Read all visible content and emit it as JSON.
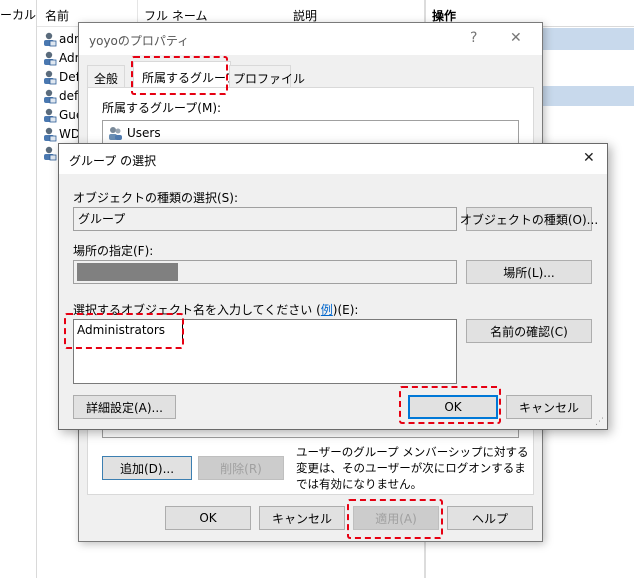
{
  "background": {
    "left_fragment": "ーカル)",
    "columns": {
      "name": "名前",
      "fullname": "フル ネーム",
      "description": "説明"
    },
    "ops_header": "操作",
    "rows": [
      "adm",
      "Adm",
      "Def",
      "def",
      "Gue",
      "WD",
      ""
    ]
  },
  "props_window": {
    "title": "yoyoのプロパティ",
    "help_glyph": "?",
    "close_glyph": "✕",
    "tabs": [
      "全般",
      "所属するグループ",
      "プロファイル"
    ],
    "member_of_label": "所属するグループ(M):",
    "groups": [
      "Users"
    ],
    "add_button": "追加(D)...",
    "remove_button": "削除(R)",
    "note": "ユーザーのグループ メンバーシップに対する変更は、そのユーザーが次にログオンするまでは有効になりません。",
    "ok": "OK",
    "cancel": "キャンセル",
    "apply": "適用(A)",
    "help": "ヘルプ"
  },
  "select_dialog": {
    "title": "グループ の選択",
    "close_glyph": "✕",
    "object_type_label": "オブジェクトの種類の選択(S):",
    "object_type_value": "グループ",
    "object_type_button": "オブジェクトの種類(O)...",
    "location_label": "場所の指定(F):",
    "location_button": "場所(L)...",
    "enter_label_prefix": "選択するオブジェクト名を入力してください (",
    "enter_label_link": "例",
    "enter_label_suffix": ")(E):",
    "enter_value": "Administrators",
    "check_names_button": "名前の確認(C)",
    "advanced_button": "詳細設定(A)...",
    "ok": "OK",
    "cancel": "キャンセル"
  },
  "colors": {
    "dialog_bg": "#f0f0f0",
    "accent": "#0078d7",
    "highlight": "#e60012",
    "link": "#0066cc"
  }
}
